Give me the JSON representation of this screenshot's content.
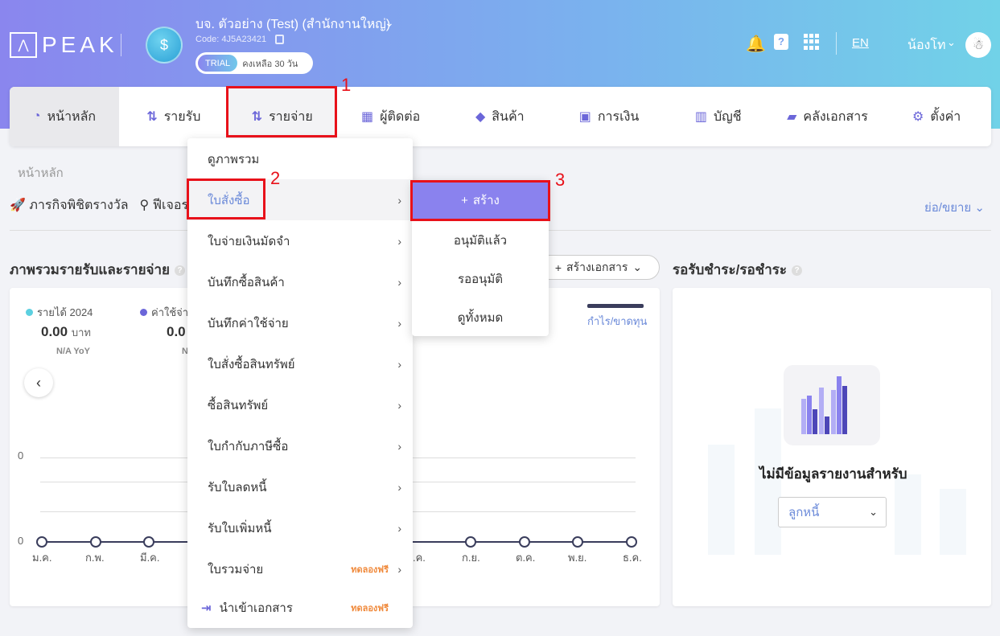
{
  "header": {
    "logo_mark": "⋀",
    "logo_text": "PEAK",
    "company_name": "บจ. ตัวอย่าง (Test) (สำนักงานใหญ่)",
    "company_code": "Code: 4J5A23421",
    "trial_badge": "TRIAL",
    "trial_text": "คงเหลือ 30 วัน",
    "lang": "EN",
    "user_name": "น้องโท"
  },
  "nav": {
    "items": [
      {
        "label": "หน้าหลัก",
        "icon": "dashboard-icon"
      },
      {
        "label": "รายรับ",
        "icon": "income-icon"
      },
      {
        "label": "รายจ่าย",
        "icon": "expense-icon"
      },
      {
        "label": "ผู้ติดต่อ",
        "icon": "contacts-icon"
      },
      {
        "label": "สินค้า",
        "icon": "box-icon"
      },
      {
        "label": "การเงิน",
        "icon": "money-icon"
      },
      {
        "label": "บัญชี",
        "icon": "book-icon"
      },
      {
        "label": "คลังเอกสาร",
        "icon": "folder-icon"
      },
      {
        "label": "ตั้งค่า",
        "icon": "gear-icon"
      }
    ]
  },
  "breadcrumb": "หน้าหลัก",
  "toolbar": {
    "mission": "ภารกิจพิชิตรางวัล",
    "feature": "ฟีเจอร",
    "collapse": "ย่อ/ขยาย"
  },
  "overview": {
    "title": "ภาพรวมรายรับและรายจ่าย",
    "create_doc": "สร้างเอกสาร",
    "income_label": "รายได้ 2024",
    "expense_label": "ค่าใช้จ่าย",
    "income_value": "0.00",
    "expense_value": "0.0",
    "currency": "บาท",
    "yoy": "N/A YoY",
    "yoy2": "N",
    "profit_label": "กำไร/ขาดทุน",
    "y_top": "0",
    "y_bottom": "0",
    "months_left": [
      "ม.ค.",
      "ก.พ.",
      "มี.ค."
    ],
    "months_right": [
      ".ค.",
      "ก.ย.",
      "ต.ค.",
      "พ.ย.",
      "ธ.ค."
    ]
  },
  "receivable": {
    "title": "รอรับชำระ/รอชำระ",
    "empty_title": "ไม่มีข้อมูลรายงานสำหรับ",
    "select_value": "ลูกหนี้"
  },
  "dropdown": {
    "items": [
      {
        "label": "ดูภาพรวม",
        "arrow": false
      },
      {
        "label": "ใบสั่งซื้อ",
        "arrow": true
      },
      {
        "label": "ใบจ่ายเงินมัดจำ",
        "arrow": true
      },
      {
        "label": "บันทึกซื้อสินค้า",
        "arrow": true
      },
      {
        "label": "บันทึกค่าใช้จ่าย",
        "arrow": true
      },
      {
        "label": "ใบสั่งซื้อสินทรัพย์",
        "arrow": true
      },
      {
        "label": "ซื้อสินทรัพย์",
        "arrow": true
      },
      {
        "label": "ใบกำกับภาษีซื้อ",
        "arrow": true
      },
      {
        "label": "รับใบลดหนี้",
        "arrow": true
      },
      {
        "label": "รับใบเพิ่มหนี้",
        "arrow": true
      },
      {
        "label": "ใบรวมจ่าย",
        "arrow": true
      },
      {
        "label": "นำเข้าเอกสาร",
        "arrow": false
      }
    ],
    "free_label": "ทดลองฟรี"
  },
  "submenu": {
    "create": "สร้าง",
    "items": [
      "อนุมัติแล้ว",
      "รออนุมัติ",
      "ดูทั้งหมด"
    ]
  },
  "annotations": [
    "1",
    "2",
    "3"
  ],
  "colors": {
    "accent": "#8a82ee",
    "highlight": "#e8111a",
    "link": "#6b8ad9"
  }
}
